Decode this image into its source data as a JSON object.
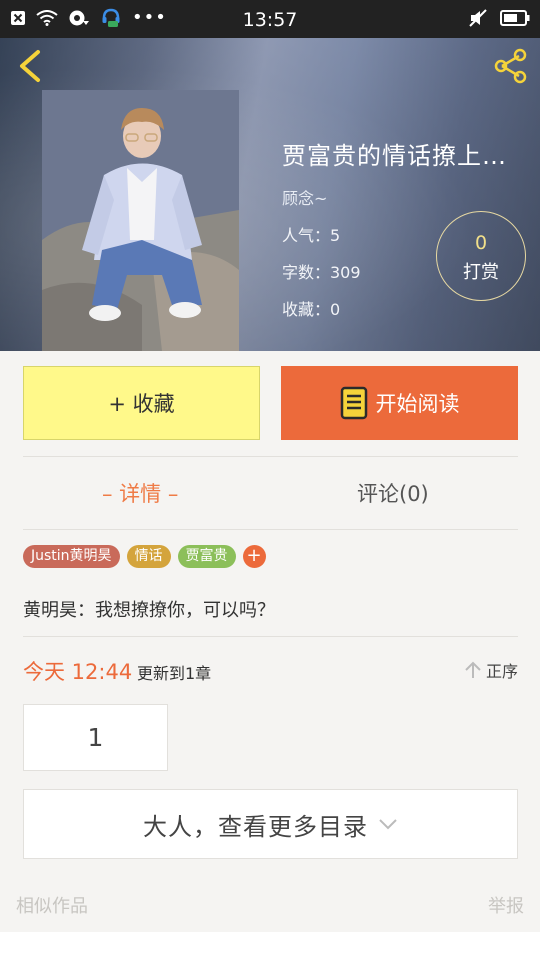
{
  "status_bar": {
    "time": "13:57",
    "left_icons": [
      "close-box-icon",
      "wifi-icon",
      "sync-icon",
      "headset-chat-icon",
      "more-dots-icon"
    ],
    "right_icons": [
      "mute-icon",
      "battery-icon"
    ]
  },
  "header": {
    "back_icon": "chevron-left-icon",
    "share_icon": "share-icon"
  },
  "book": {
    "title": "贾富贵的情话撩上…",
    "author": "顾念~",
    "popularity": "人气：5",
    "word_count": "字数：309",
    "favorites": "收藏：0"
  },
  "reward": {
    "count": "0",
    "label": "打赏"
  },
  "actions": {
    "collect_label": "+ 收藏",
    "read_label": "开始阅读"
  },
  "tabs": {
    "detail_label": "– 详情 –",
    "comment_label": "评论(0)"
  },
  "tags": [
    {
      "label": "Justin黄明昊",
      "color": "#c96a5a"
    },
    {
      "label": "情话",
      "color": "#d4a43c"
    },
    {
      "label": "贾富贵",
      "color": "#8cbf5a"
    }
  ],
  "tag_add_label": "+",
  "summary": "黄明昊：我想撩撩你，可以吗？",
  "update": {
    "time": "今天 12:44",
    "text": "更新到1章",
    "sort_label": "正序"
  },
  "chapter": {
    "label": "1"
  },
  "more_catalog_label": "大人，查看更多目录",
  "footer": {
    "similar_label": "相似作品",
    "report_label": "举报"
  },
  "colors": {
    "accent": "#ec6a3b",
    "collect_bg": "#fff98a",
    "icon_yellow": "#f5d33a"
  }
}
